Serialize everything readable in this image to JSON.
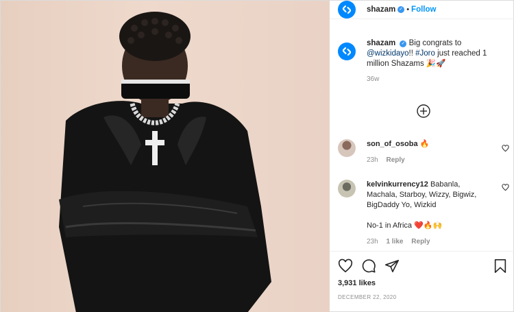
{
  "header": {
    "username": "shazam",
    "separator": "•",
    "follow_label": "Follow"
  },
  "caption": {
    "username": "shazam",
    "text_start": "Big congrats to",
    "mention": "@wizkidayo",
    "text_mid": "!! ",
    "hashtag": "#Joro",
    "text_end": " just reached 1 million Shazams 🎉🚀",
    "time": "36w"
  },
  "comments": [
    {
      "username": "son_of_osoba",
      "text": "🔥",
      "time": "23h",
      "likes": "",
      "reply_label": "Reply"
    },
    {
      "username": "kelvinkurrency12",
      "text": "Babanla, Machala, Starboy, Wizzy, Bigwiz, BigDaddy Yo, Wizkid",
      "text2": "No-1 in Africa ❤️🔥🙌",
      "time": "23h",
      "likes": "1 like",
      "reply_label": "Reply"
    }
  ],
  "actions": {
    "likes_count": "3,931 likes",
    "date": "DECEMBER 22, 2020"
  },
  "icons": {
    "brand": "shazam-logo-icon",
    "verified": "verified-badge-icon",
    "load_more": "plus-circle-icon",
    "like": "heart-icon",
    "comment": "comment-icon",
    "share": "send-icon",
    "save": "bookmark-icon"
  },
  "colors": {
    "brand_blue": "#0088ff",
    "link_blue": "#0095f6",
    "verified_blue": "#3897f0",
    "muted": "#8e8e8e"
  }
}
